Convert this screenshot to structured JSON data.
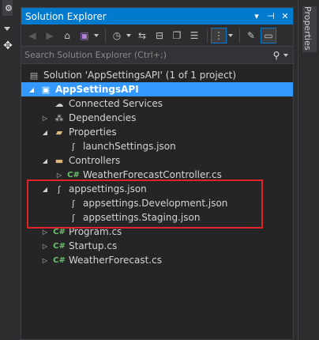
{
  "window": {
    "title": "Solution Explorer",
    "title_buttons": [
      "▾",
      "⊣",
      "✕"
    ]
  },
  "side_tab": {
    "label": "Properties"
  },
  "toolbar": {
    "icons": [
      "back-icon",
      "forward-icon",
      "home-icon",
      "vs-icon",
      "history-icon",
      "sync-icon",
      "collapse-all-icon",
      "copy-icon",
      "show-all-files-icon",
      "view-icon",
      "wrench-icon",
      "preview-icon"
    ]
  },
  "search": {
    "placeholder": "Search Solution Explorer (Ctrl+;)"
  },
  "tree": {
    "solution": "Solution 'AppSettingsAPI' (1 of 1 project)",
    "project": "AppSettingsAPI",
    "connected_services": "Connected Services",
    "dependencies": "Dependencies",
    "properties": "Properties",
    "launch_settings": "launchSettings.json",
    "controllers": "Controllers",
    "weather_controller": "WeatherForecastController.cs",
    "appsettings": "appsettings.json",
    "appsettings_dev": "appsettings.Development.json",
    "appsettings_staging": "appsettings.Staging.json",
    "program": "Program.cs",
    "startup": "Startup.cs",
    "weather_forecast": "WeatherForecast.cs"
  },
  "colors": {
    "accent": "#007acc",
    "selection": "#3399ff",
    "highlight_box": "#e0222a",
    "csharp_icon": "#68c26b",
    "folder_icon": "#dcb67a"
  }
}
